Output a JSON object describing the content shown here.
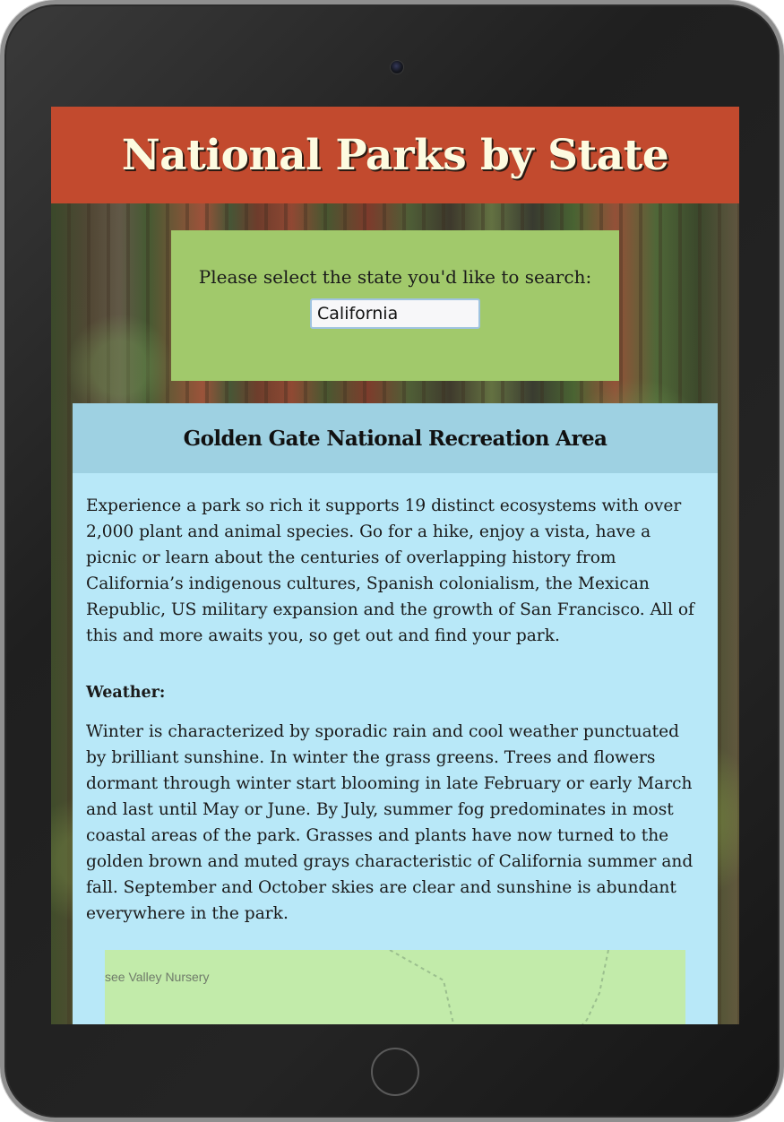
{
  "header": {
    "title": "National Parks by State"
  },
  "search": {
    "label": "Please select the state you'd like to search:",
    "selected_state": "California"
  },
  "park": {
    "name": "Golden Gate National Recreation Area",
    "description": "Experience a park so rich it supports 19 distinct ecosystems with over 2,000 plant and animal species. Go for a hike, enjoy a vista, have a picnic or learn about the centuries of overlapping history from California’s indigenous cultures, Spanish colonialism, the Mexican Republic, US military expansion and the growth of San Francisco. All of this and more awaits you, so get out and find your park.",
    "weather_heading": "Weather:",
    "weather_text": "Winter is characterized by sporadic rain and cool weather punctuated by brilliant sunshine. In winter the grass greens. Trees and flowers dormant through winter start blooming in late February or early March and last until May or June. By July, summer fog predominates in most coastal areas of the park. Grasses and plants have now turned to the golden brown and muted grays characteristic of California summer and fall. September and October skies are clear and sunshine is abundant everywhere in the park."
  },
  "map": {
    "place_label": "see Valley Nursery"
  },
  "colors": {
    "header_bg": "#c24a2e",
    "header_text": "#fdfbe0",
    "search_panel_bg": "#a1c96b",
    "card_bg": "#b8e8f8",
    "card_header_bg": "#9ed1e2",
    "map_bg": "#c2ebaa"
  }
}
